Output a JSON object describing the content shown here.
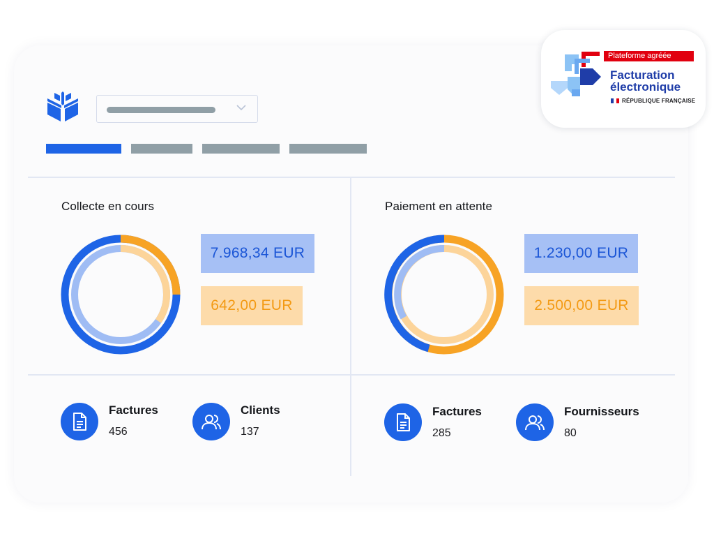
{
  "colors": {
    "accent": "#1e64e6",
    "orange": "#f7a325",
    "light_blue": "#a6c0f5",
    "light_orange": "#fddbaa",
    "tab_inactive": "#909fa6"
  },
  "header": {
    "logo_icon": "company-logo-icon",
    "tabs": [
      {
        "state": "active"
      },
      {
        "state": "inactive"
      },
      {
        "state": "inactive"
      },
      {
        "state": "inactive"
      }
    ]
  },
  "panels": {
    "collecte": {
      "title": "Collecte en cours",
      "amount_primary": "7.968,34 EUR",
      "amount_secondary": "642,00 EUR",
      "stats": [
        {
          "label": "Factures",
          "value": "456",
          "icon": "document-icon"
        },
        {
          "label": "Clients",
          "value": "137",
          "icon": "users-icon"
        }
      ]
    },
    "paiement": {
      "title": "Paiement en attente",
      "amount_primary": "1.230,00 EUR",
      "amount_secondary": "2.500,00 EUR",
      "stats": [
        {
          "label": "Factures",
          "value": "285",
          "icon": "document-icon"
        },
        {
          "label": "Fournisseurs",
          "value": "80",
          "icon": "users-icon"
        }
      ]
    }
  },
  "badge": {
    "ribbon": "Plateforme agréée",
    "title_line1": "Facturation",
    "title_line2": "électronique",
    "republique": "RÉPUBLIQUE FRANÇAISE"
  }
}
